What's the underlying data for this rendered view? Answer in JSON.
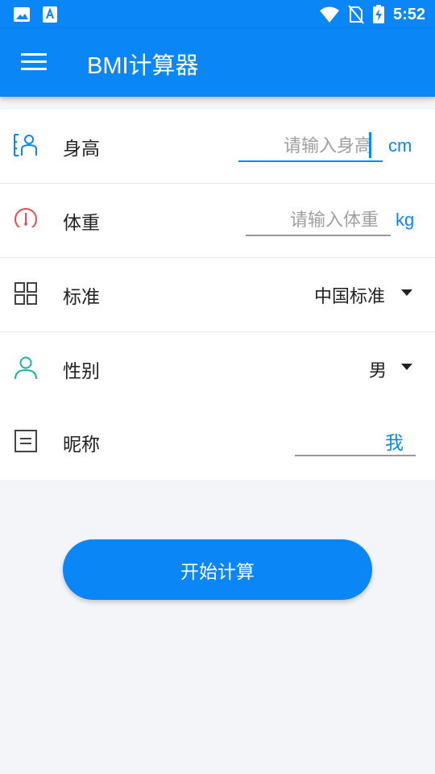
{
  "statusbar": {
    "time": "5:52"
  },
  "appbar": {
    "title": "BMI计算器"
  },
  "form": {
    "height": {
      "label": "身高",
      "placeholder": "请输入身高",
      "unit": "cm"
    },
    "weight": {
      "label": "体重",
      "placeholder": "请输入体重",
      "unit": "kg"
    },
    "standard": {
      "label": "标准",
      "value": "中国标准"
    },
    "gender": {
      "label": "性别",
      "value": "男"
    },
    "nickname": {
      "label": "昵称",
      "value": "我"
    }
  },
  "action": {
    "calculate_label": "开始计算"
  },
  "colors": {
    "primary": "#0a86f6",
    "weight_icon": "#e84d55",
    "gender_icon": "#1ab3a6"
  }
}
